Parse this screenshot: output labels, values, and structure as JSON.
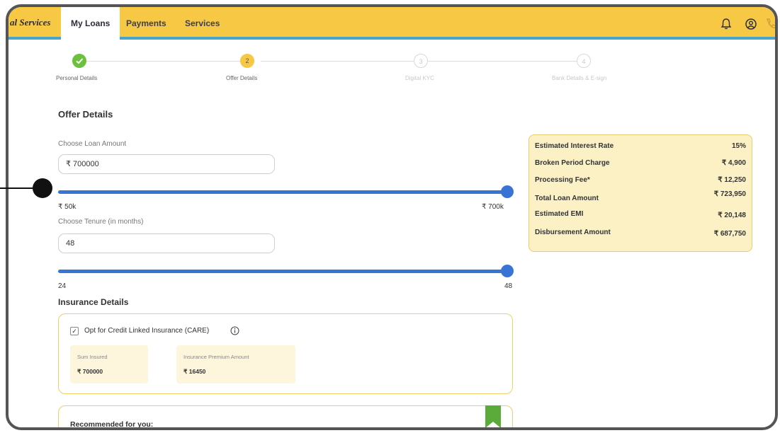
{
  "header": {
    "brand": "al Services",
    "tabs": [
      {
        "label": "My Loans",
        "active": true
      },
      {
        "label": "Payments",
        "active": false
      },
      {
        "label": "Services",
        "active": false
      }
    ],
    "icons": [
      "bell-icon",
      "user-circle-icon",
      "phone-icon"
    ]
  },
  "stepper": {
    "steps": [
      {
        "number": "1",
        "label": "Personal Details",
        "status": "completed"
      },
      {
        "number": "2",
        "label": "Offer Details",
        "status": "active"
      },
      {
        "number": "3",
        "label": "Digital KYC",
        "status": "pending"
      },
      {
        "number": "4",
        "label": "Bank Details & E-sign",
        "status": "pending"
      }
    ]
  },
  "offer": {
    "title": "Offer Details",
    "loan_amount": {
      "label": "Choose Loan Amount",
      "value": "₹ 700000",
      "min_label": "₹ 50k",
      "max_label": "₹ 700k",
      "slider_fraction": 1.0
    },
    "tenure": {
      "label": "Choose Tenure (in months)",
      "value": "48",
      "min_label": "24",
      "max_label": "48",
      "slider_fraction": 1.0
    }
  },
  "summary": {
    "rows": [
      {
        "label": "Estimated Interest Rate",
        "value": "15%"
      },
      {
        "label": "Broken Period Charge",
        "value": "₹ 4,900"
      },
      {
        "label": "Processing Fee*",
        "value": "₹ 12,250"
      },
      {
        "label": "Total Loan Amount",
        "value": "₹ 723,950"
      },
      {
        "label": "Estimated EMI",
        "value": "₹ 20,148"
      },
      {
        "label": "Disbursement Amount",
        "value": "₹ 687,750"
      }
    ]
  },
  "insurance": {
    "title": "Insurance Details",
    "opt_label": "Opt for Credit Linked Insurance (CARE)",
    "checked": true,
    "sum_insured_label": "Sum Insured",
    "sum_insured_value": "₹ 700000",
    "premium_label": "Insurance Premium Amount",
    "premium_value": "₹ 16450"
  },
  "recommended": {
    "title": "Recommended for you:"
  },
  "colors": {
    "header_bg": "#f6c843",
    "accent_blue": "#3a73d6",
    "success_green": "#6cbf3f",
    "summary_bg": "#fbf1c4"
  }
}
